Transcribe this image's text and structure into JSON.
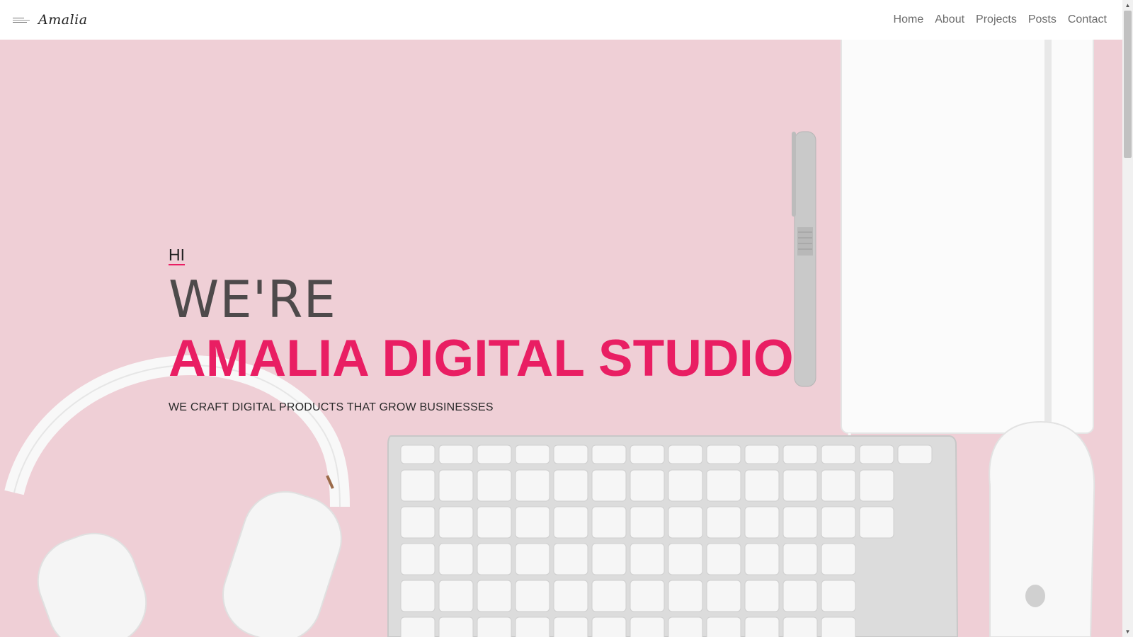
{
  "navbar": {
    "brand": "Amalia",
    "links": [
      "Home",
      "About",
      "Projects",
      "Posts",
      "Contact"
    ]
  },
  "hero": {
    "hi": "HI",
    "were": "WE'RE",
    "title": "AMALIA DIGITAL STUDIO",
    "subtitle": "WE CRAFT DIGITAL PRODUCTS THAT GROW BUSINESSES"
  },
  "colors": {
    "accent": "#e91e63",
    "hero_background": "#efcfd6"
  },
  "icons": {
    "brand": "logo-icon",
    "scroll_up": "triangle-up-icon",
    "scroll_down": "triangle-down-icon"
  }
}
